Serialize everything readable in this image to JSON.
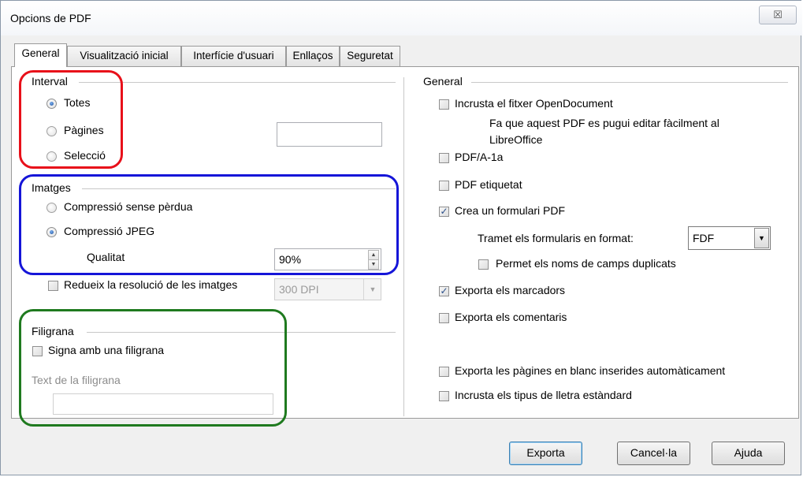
{
  "window": {
    "title": "Opcions de PDF",
    "close_glyph": "☒"
  },
  "tabs": [
    {
      "label": "General"
    },
    {
      "label": "Visualització inicial"
    },
    {
      "label": "Interfície d'usuari"
    },
    {
      "label": "Enllaços"
    },
    {
      "label": "Seguretat"
    }
  ],
  "left": {
    "interval": {
      "title": "Interval",
      "options": [
        "Totes",
        "Pàgines",
        "Selecció"
      ],
      "selected": "Totes",
      "pages_value": ""
    },
    "imatges": {
      "title": "Imatges",
      "options": [
        "Compressió sense pèrdua",
        "Compressió JPEG"
      ],
      "selected": "Compressió JPEG",
      "quality_label": "Qualitat",
      "quality_value": "90%",
      "reduce_label": "Redueix la resolució de les imatges",
      "reduce_checked": false,
      "dpi_value": "300 DPI"
    },
    "filigrana": {
      "title": "Filigrana",
      "sign_label": "Signa amb una filigrana",
      "sign_checked": false,
      "text_label": "Text de la filigrana",
      "text_value": ""
    }
  },
  "right": {
    "title": "General",
    "embed_label": "Incrusta el fitxer OpenDocument",
    "embed_desc_1": "Fa que aquest PDF es pugui editar fàcilment al",
    "embed_desc_2": "LibreOffice",
    "pdfa_label": "PDF/A-1a",
    "tagged_label": "PDF etiquetat",
    "form_label": "Crea un formulari PDF",
    "submit_label": "Tramet els formularis en format:",
    "submit_value": "FDF",
    "duplicate_label": "Permet els noms de camps duplicats",
    "bookmarks_label": "Exporta els marcadors",
    "comments_label": "Exporta els comentaris",
    "blank_label": "Exporta les pàgines en blanc inserides automàticament",
    "fonts_label": "Incrusta els tipus de lletra estàndard",
    "checked": {
      "embed": false,
      "pdfa": false,
      "tagged": false,
      "form": true,
      "duplicate": false,
      "bookmarks": true,
      "comments": false,
      "blank": false,
      "fonts": false
    }
  },
  "buttons": {
    "export": "Exporta",
    "cancel": "Cancel·la",
    "help": "Ajuda"
  },
  "annotations": {
    "red": "#e8101a",
    "blue": "#1515d8",
    "green": "#1f7a1f"
  }
}
